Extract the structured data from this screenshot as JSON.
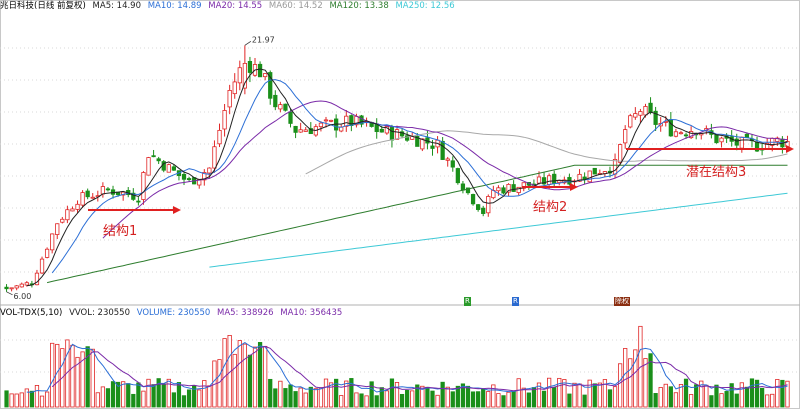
{
  "header": {
    "title": "兆日科技(日线 前复权)",
    "ma5": "MA5: 14.90",
    "ma10": "MA10: 14.89",
    "ma20": "MA20: 14.55",
    "ma60": "MA60: 14.52",
    "ma120": "MA120: 13.38",
    "ma250": "MA250: 12.56"
  },
  "volume_header": {
    "title": "VOL-TDX(5,10)",
    "vvol": "VVOL: 230550",
    "volume": "VOLUME: 230550",
    "ma5": "MA5: 338926",
    "ma10": "MA10: 356435"
  },
  "colors": {
    "up": "#e02525",
    "down": "#1a8f1a",
    "ma5": "#222222",
    "ma10": "#2c6fd6",
    "ma20": "#7a2aa8",
    "ma60": "#a8a8a8",
    "ma120": "#2e7d2e",
    "ma250": "#3ec9d6",
    "arrow": "#e02020",
    "tag_green": "#2a9a2a",
    "tag_blue": "#2a6ad0",
    "tag_brown": "#8b2e10"
  },
  "annotations": [
    {
      "text": "结构1"
    },
    {
      "text": "结构2"
    },
    {
      "text": "潜在结构3"
    }
  ],
  "event_tags": [
    "R",
    "R",
    "除权"
  ],
  "chart_data": [
    {
      "type": "candlestick",
      "title": "兆日科技(日线 前复权)",
      "price_labels": {
        "high": "21.97",
        "low": "6.00"
      },
      "ylim": [
        5.6,
        24
      ],
      "candles": [],
      "ma": {}
    },
    {
      "type": "bar",
      "title": "VOL-TDX(5,10)",
      "ylim": [
        0,
        1200000
      ],
      "values": []
    }
  ]
}
